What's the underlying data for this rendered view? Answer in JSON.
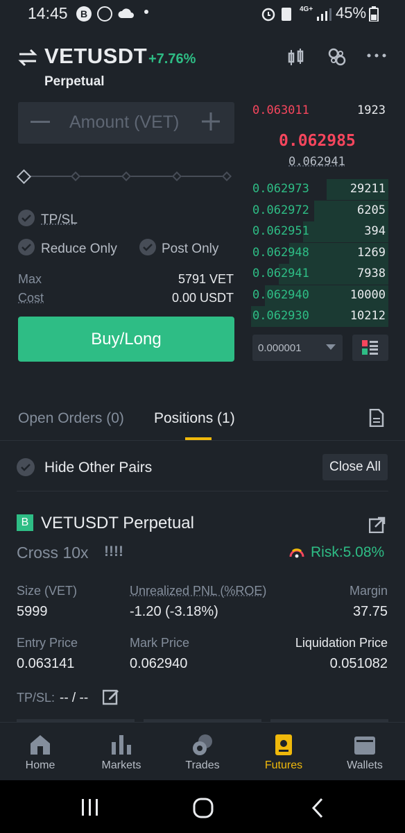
{
  "status_bar": {
    "time": "14:45",
    "network": "4G+",
    "battery": "45%"
  },
  "header": {
    "pair": "VETUSDT",
    "change": "+7.76%",
    "contract_type": "Perpetual"
  },
  "order_form": {
    "amount_placeholder": "Amount (VET)",
    "tpsl_label": "TP/SL",
    "reduce_only_label": "Reduce Only",
    "post_only_label": "Post Only",
    "max_label": "Max",
    "max_value": "5791 VET",
    "cost_label": "Cost",
    "cost_value": "0.00 USDT",
    "buy_label": "Buy/Long"
  },
  "order_book": {
    "asks": [
      {
        "price": "0.063011",
        "qty": "1923"
      }
    ],
    "last_price": "0.062985",
    "mark_price": "0.062941",
    "bids": [
      {
        "price": "0.062973",
        "qty": "29211",
        "depth": 0.45
      },
      {
        "price": "0.062972",
        "qty": "6205",
        "depth": 0.54
      },
      {
        "price": "0.062951",
        "qty": "394",
        "depth": 0.62
      },
      {
        "price": "0.062948",
        "qty": "1269",
        "depth": 0.72
      },
      {
        "price": "0.062941",
        "qty": "7938",
        "depth": 0.8
      },
      {
        "price": "0.062940",
        "qty": "10000",
        "depth": 0.9
      },
      {
        "price": "0.062930",
        "qty": "10212",
        "depth": 1.0
      }
    ],
    "precision": "0.000001"
  },
  "tabs": {
    "open_orders": "Open Orders (0)",
    "positions": "Positions (1)"
  },
  "filters": {
    "hide_other_pairs": "Hide Other Pairs",
    "close_all": "Close All"
  },
  "position": {
    "badge": "B",
    "symbol": "VETUSDT Perpetual",
    "margin_mode": "Cross 10x",
    "warning": "!!!!",
    "risk": "Risk:5.08%",
    "size_label": "Size (VET)",
    "size_value": "5999",
    "pnl_label": "Unrealized PNL (%ROE)",
    "pnl_value": "-1.20 (-3.18%)",
    "margin_label": "Margin",
    "margin_value": "37.75",
    "entry_label": "Entry Price",
    "entry_value": "0.063141",
    "mark_label": "Mark Price",
    "mark_value": "0.062940",
    "liq_label": "Liquidation Price",
    "liq_value": "0.051082",
    "tpsl_label": "TP/SL:",
    "tpsl_value": "-- / --"
  },
  "bottom_nav": [
    {
      "label": "Home",
      "icon": "home-icon"
    },
    {
      "label": "Markets",
      "icon": "markets-icon"
    },
    {
      "label": "Trades",
      "icon": "trades-icon"
    },
    {
      "label": "Futures",
      "icon": "futures-icon",
      "active": true
    },
    {
      "label": "Wallets",
      "icon": "wallet-icon"
    }
  ],
  "colors": {
    "green": "#2ebd85",
    "red": "#f6465d",
    "yellow": "#f0b90b",
    "background": "#1e2329"
  }
}
